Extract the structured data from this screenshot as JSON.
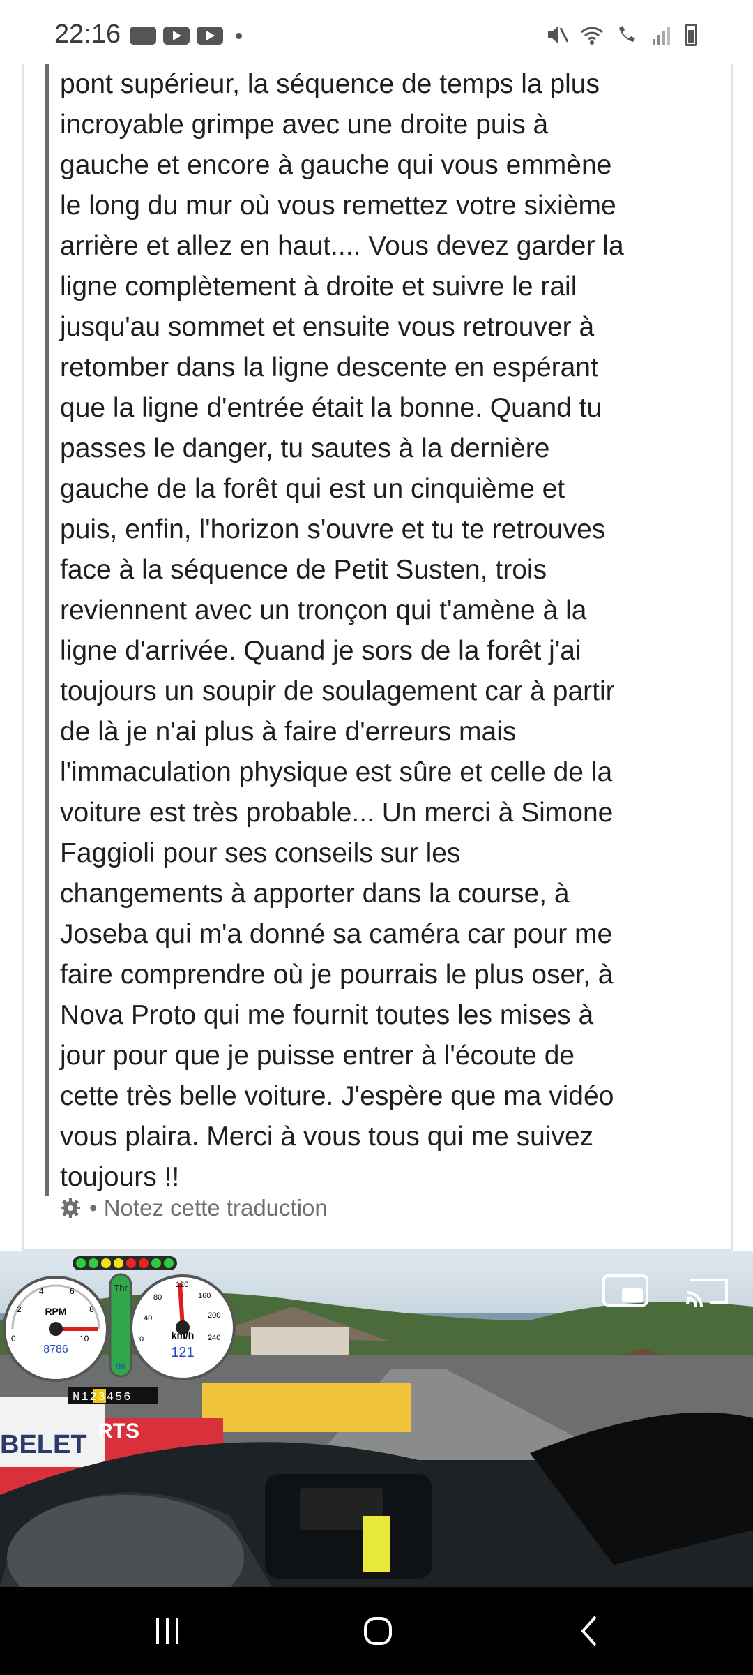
{
  "status_bar": {
    "time": "22:16"
  },
  "post": {
    "lines": [
      "pont supérieur, la séquence de temps la plus",
      "incroyable grimpe avec une droite puis à",
      "gauche et encore à gauche qui vous emmène",
      "le long du mur où vous remettez votre sixième",
      "arrière et allez en haut.... Vous devez garder la",
      "ligne complètement à droite et suivre le rail",
      "jusqu'au sommet et ensuite vous retrouver à",
      "retomber dans la ligne descente en espérant",
      "que la ligne d'entrée était la bonne. Quand tu",
      "passes le danger, tu sautes à la dernière",
      "gauche de la forêt qui est un cinquième et",
      "puis, enfin, l'horizon s'ouvre et tu te retrouves",
      "face à la séquence de Petit Susten, trois",
      "reviennent avec un tronçon qui t'amène à la",
      "ligne d'arrivée. Quand je sors de la forêt j'ai",
      "toujours un soupir de soulagement car à partir",
      "de là je n'ai plus à faire d'erreurs mais",
      "l'immaculation physique est sûre et celle de la",
      "voiture est très probable... Un merci à Simone",
      "Faggioli pour ses conseils sur les",
      "changements à apporter dans la course, à",
      "Joseba qui m'a donné sa caméra car pour me",
      "faire comprendre où je pourrais le plus oser, à",
      "Nova Proto qui me fournit toutes les mises à",
      "jour pour que je puisse entrer à l'écoute de",
      "cette très belle voiture. J'espère que ma vidéo",
      "vous plaira. Merci à vous tous qui me suivez",
      "toujours !!"
    ],
    "rate_translation": "• Notez cette traduction"
  },
  "video": {
    "hud": {
      "rpm_label": "RPM",
      "rpm_value": "8786",
      "speed_label": "km/h",
      "speed_value": "121",
      "throttle_label": "Thr",
      "throttle_value": "98",
      "gear_strip": "N123456",
      "rpm_ticks": [
        "0",
        "2",
        "4",
        "6",
        "8",
        "10"
      ],
      "speed_ticks": [
        "0",
        "40",
        "80",
        "120",
        "160",
        "200",
        "240"
      ],
      "brand_text": "RTS",
      "banner_text": "BELET"
    }
  },
  "colors": {
    "quote_bar": "#6c6c6c",
    "text": "#1f1f1f",
    "muted": "#6f6f6f",
    "nav_bg": "#000000"
  }
}
